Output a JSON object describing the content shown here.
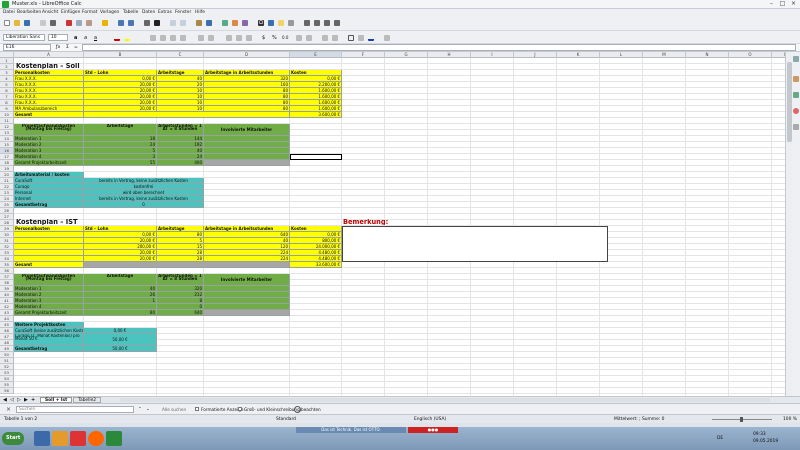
{
  "window": {
    "title": "Muster.xls - LibreOffice Calc"
  },
  "menu": [
    "Datei",
    "Bearbeiten",
    "Ansicht",
    "Einfügen",
    "Format",
    "Vorlagen",
    "Tabelle",
    "Daten",
    "Extras",
    "Fenster",
    "Hilfe"
  ],
  "formatting": {
    "font_name": "Liberation Sans",
    "font_size": "10"
  },
  "formula_bar": {
    "cell_ref": "E16",
    "content": ""
  },
  "columns": [
    "A",
    "B",
    "C",
    "D",
    "E",
    "F",
    "G",
    "H",
    "I",
    "J",
    "K",
    "L",
    "M",
    "N",
    "O",
    "P"
  ],
  "sheet": {
    "soll_title": "Kostenplan – Soll",
    "soll_headers": [
      "Personalkosten",
      "Std – Lohn",
      "Arbeitstage",
      "Arbeitstage in Arbeitsstunden",
      "Kosten"
    ],
    "soll_rows": [
      [
        "Frau X.X.X.",
        "0,00 €",
        "40",
        "320",
        "0,00 €"
      ],
      [
        "Frau X.X.X.",
        "20,00 €",
        "20",
        "160",
        "2.200,00 €"
      ],
      [
        "Frau X.X.X.",
        "20,00 €",
        "10",
        "80",
        "1.600,00 €"
      ],
      [
        "Frau X.X.X.",
        "20,00 €",
        "10",
        "80",
        "1.600,00 €"
      ],
      [
        "Frau X.X.X.",
        "20,00 €",
        "10",
        "80",
        "1.600,00 €"
      ],
      [
        "MA Ambulanzbereich",
        "20,00 €",
        "10",
        "80",
        "1.600,00 €"
      ]
    ],
    "soll_total": [
      "Gesamt",
      "",
      "",
      "",
      "3.600,00 €"
    ],
    "proj_headers": [
      "Projektaufwandskosten (Montag bis Freitag)",
      "Arbeitstage",
      "Arbeitsstunden = 1 AT = 8 Stunden",
      "Involvierte Mitarbeiter"
    ],
    "proj_rows": [
      [
        "Moderation 1",
        "18",
        "144"
      ],
      [
        "Moderation 2",
        "24",
        "192"
      ],
      [
        "Moderation 3",
        "5",
        "40"
      ],
      [
        "Moderation 4",
        "3",
        "24"
      ]
    ],
    "proj_total": [
      "Gesamt Projektarbeitszeit",
      "55",
      "400"
    ],
    "arbeitsmaterial_title": "Arbeitsmaterial / kosten",
    "arbeitsmaterial_rows": [
      [
        "CuraSoft",
        "bereits in Vertrag, keine zusätzlichen Kosten"
      ],
      [
        "Curaqo",
        "kostenfrei"
      ],
      [
        "Personal",
        "wird oben berechnet"
      ],
      [
        "Internet",
        "bereits in Vertrag, keine zusätzlichen Kosten"
      ]
    ],
    "gesamtbetrag": [
      "Gesamtbetrag",
      "0"
    ],
    "ist_title": "Kostenplan – IST",
    "bemerkung": "Bemerkung:",
    "ist_headers": [
      "Personalkosten",
      "Std – Lohn",
      "Arbeitstage",
      "Arbeitstage in Arbeitsstunden",
      "Kosten"
    ],
    "ist_rows": [
      [
        "",
        "0,00 €",
        "80",
        "640",
        "0,00 €"
      ],
      [
        "",
        "20,00 €",
        "5",
        "40",
        "800,00 €"
      ],
      [
        "",
        "200,00 €",
        "15",
        "120",
        "24.000,00 €"
      ],
      [
        "",
        "20,00 €",
        "28",
        "224",
        "4.480,00 €"
      ],
      [
        "",
        "20,00 €",
        "28",
        "224",
        "4.480,00 €"
      ]
    ],
    "ist_total": [
      "Gesamt",
      "",
      "",
      "",
      "33.600,00 €"
    ],
    "proj2_rows": [
      [
        "Moderation 1",
        "40",
        "320"
      ],
      [
        "Moderation 2",
        "26",
        "212"
      ],
      [
        "Moderation 3",
        "1",
        "8"
      ],
      [
        "Moderation 4",
        "",
        "0"
      ]
    ],
    "proj2_total": [
      "Gesamt Projektarbeitszeit",
      "80",
      "640"
    ],
    "weitere_title": "Weitere Projektkosten",
    "weitere_rows": [
      [
        "CuraSoft (keine zusätzlichen Kosten)",
        "0,00 €"
      ],
      [
        "Curaqo (1. Monat Kostenlos) pro Monat 50 €",
        "50,00 €"
      ]
    ],
    "weitere_total": [
      "Gesamtbetrag",
      "50,00 €"
    ]
  },
  "tabs": [
    "Soll + Ist",
    "Tabelle2"
  ],
  "findbar": {
    "placeholder": "Suchen",
    "find_all": "Alle suchen",
    "formatted": "Formatierte Anzeige",
    "match_case": "Groß- und Kleinschreibung beachten"
  },
  "status": {
    "sheet": "Tabelle 1 von 2",
    "style": "Standard",
    "lang": "Englisch (USA)",
    "summary": "Mittelwert: ; Summe: 0",
    "zoom": "100 %"
  },
  "taskbar": {
    "start": "Start",
    "ad": "Das ist Technik. Das ist OTTO.",
    "lang": "DE",
    "time": "09:33",
    "date": "09.05.2019"
  },
  "colors": {
    "yellow": "#ffff00",
    "green": "#70ad47",
    "turquoise": "#4bc4c0",
    "grey": "#a6a6a6",
    "red_text": "#c00000"
  }
}
